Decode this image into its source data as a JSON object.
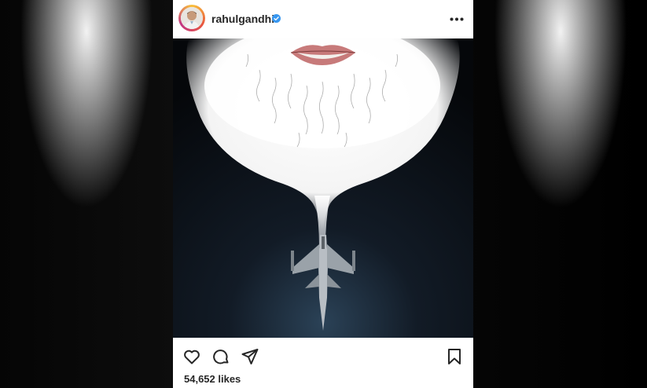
{
  "post": {
    "username": "rahulgandhi",
    "verified": true,
    "likes_text": "54,652 likes"
  },
  "icons": {
    "more": "more-options-icon",
    "like": "heart-icon",
    "comment": "comment-icon",
    "share": "share-icon",
    "save": "bookmark-icon",
    "verified": "verified-badge-icon"
  },
  "colors": {
    "text": "#262626",
    "verified": "#3897f0",
    "photo_bg": "#0a0f17"
  }
}
